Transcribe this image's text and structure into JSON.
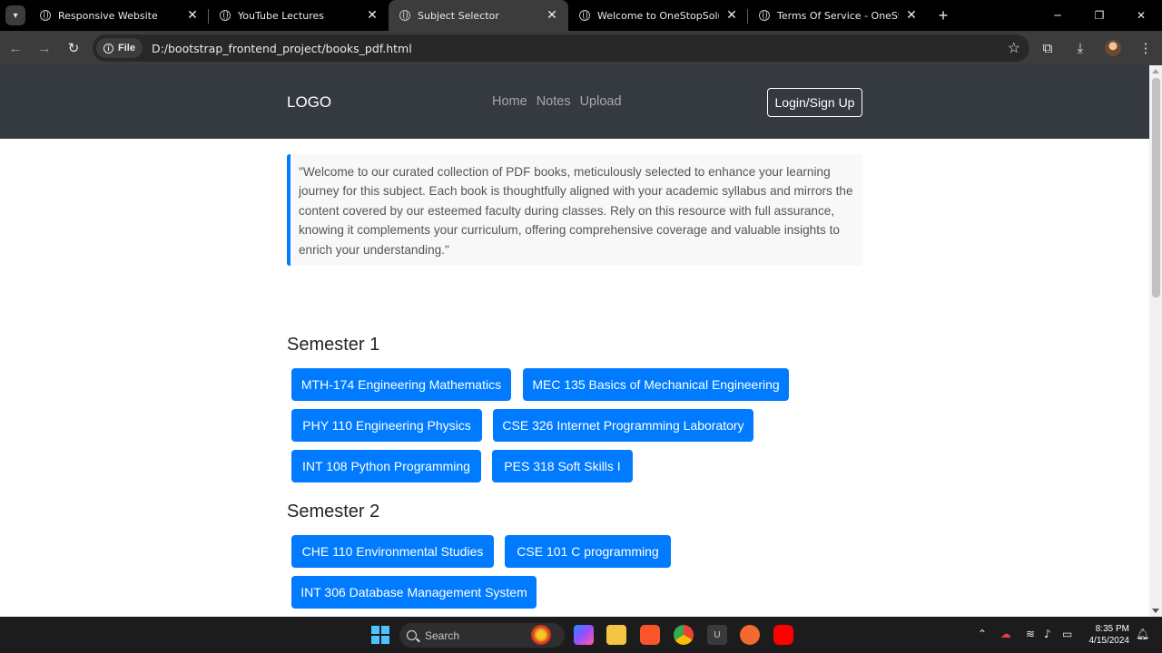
{
  "browser": {
    "tabs": [
      {
        "title": "Responsive Website",
        "active": false
      },
      {
        "title": "YouTube Lectures",
        "active": false
      },
      {
        "title": "Subject Selector",
        "active": true
      },
      {
        "title": "Welcome to OneStopSolutions.",
        "active": false
      },
      {
        "title": "Terms Of Service - OneStopSol",
        "active": false
      }
    ],
    "new_tab": "+",
    "scheme_chip": "File",
    "url": "D:/bootstrap_frontend_project/books_pdf.html"
  },
  "site": {
    "logo": "LOGO",
    "nav_links": [
      "Home",
      "Notes",
      "Upload"
    ],
    "login_button": "Login/Sign Up",
    "intro_quote": "\"Welcome to our curated collection of PDF books, meticulously selected to enhance your learning journey for this subject. Each book is thoughtfully aligned with your academic syllabus and mirrors the content covered by our esteemed faculty during classes. Rely on this resource with full assurance, knowing it complements your curriculum, offering comprehensive coverage and valuable insights to enrich your understanding.\"",
    "semesters": [
      {
        "title": "Semester 1",
        "subjects": [
          "MTH-174 Engineering Mathematics",
          "MEC 135 Basics of Mechanical Engineering",
          "PHY 110 Engineering Physics",
          "CSE 326 Internet Programming Laboratory",
          "INT 108 Python Programming",
          "PES 318 Soft Skills I"
        ]
      },
      {
        "title": "Semester 2",
        "subjects": [
          "CHE 110 Environmental Studies",
          "CSE 101 C programming",
          "INT 306 Database Management System"
        ]
      }
    ]
  },
  "taskbar": {
    "search_placeholder": "Search",
    "time": "8:35 PM",
    "date": "4/15/2024"
  },
  "colors": {
    "primary": "#007bff",
    "navbar": "#343a40",
    "quote_border": "#007bff"
  }
}
